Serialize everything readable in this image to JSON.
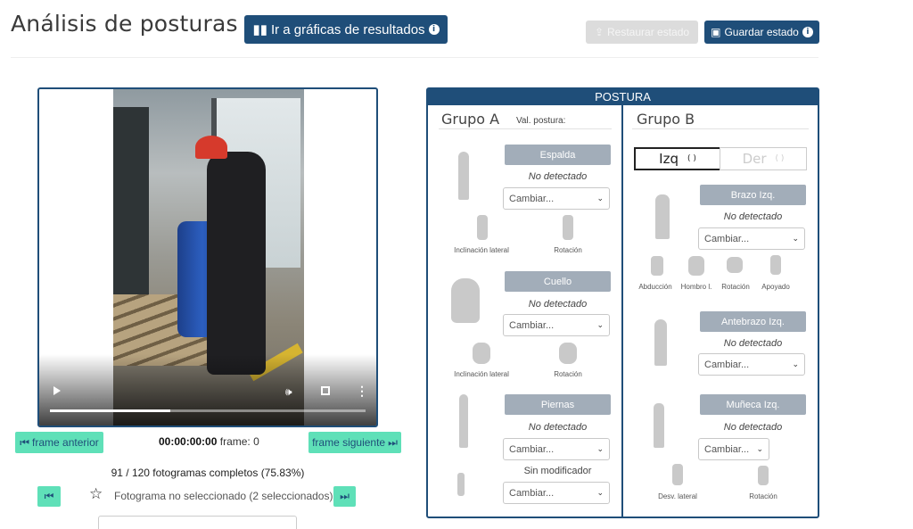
{
  "header": {
    "title": "Análisis de posturas",
    "graphs_button": "Ir a gráficas de resultados",
    "restore_button": "Restaurar estado",
    "save_button": "Guardar estado",
    "info_glyph": "i"
  },
  "video": {
    "progress_fraction": 0.38,
    "prev_frame_label": "frame anterior",
    "next_frame_label": "frame siguiente",
    "timecode": "00:00:00:00",
    "frame_label": "frame: 0",
    "frames_complete": "91 / 120 fotogramas completos (75.83%)",
    "selection_status": "Fotograma no seleccionado (2 seleccionados)",
    "star_glyph": "☆",
    "first_glyph": "⏮",
    "last_glyph": "⏭",
    "prev_glyph": "⏮",
    "next_glyph": "⏭",
    "vol_glyph": "🕪",
    "more_glyph": "⋮"
  },
  "posture": {
    "header": "POSTURA",
    "group_a": {
      "title": "Grupo A",
      "val_label": "Val. postura:",
      "espalda": {
        "label": "Espalda",
        "status": "No detectado",
        "select": "Cambiar...",
        "cap1": "Inclinación lateral",
        "cap2": "Rotación"
      },
      "cuello": {
        "label": "Cuello",
        "status": "No detectado",
        "select": "Cambiar...",
        "cap1": "Inclinación lateral",
        "cap2": "Rotación"
      },
      "piernas": {
        "label": "Piernas",
        "status": "No detectado",
        "select": "Cambiar...",
        "modifier": "Sin modificador",
        "select2": "Cambiar..."
      }
    },
    "group_b": {
      "title": "Grupo B",
      "tab_left": "Izq",
      "tab_right": "Der",
      "paren": "( )",
      "brazo": {
        "label": "Brazo Izq.",
        "status": "No detectado",
        "select": "Cambiar...",
        "caps": [
          "Abducción",
          "Hombro l.",
          "Rotación",
          "Apoyado"
        ]
      },
      "antebrazo": {
        "label": "Antebrazo Izq.",
        "status": "No detectado",
        "select": "Cambiar..."
      },
      "muneca": {
        "label": "Muñeca Izq.",
        "status": "No detectado",
        "select": "Cambiar...",
        "cap1": "Desv. lateral",
        "cap2": "Rotación"
      }
    }
  },
  "colors": {
    "primary": "#1f4e79",
    "accent": "#5fe0b8",
    "segment": "#a2adb9"
  }
}
